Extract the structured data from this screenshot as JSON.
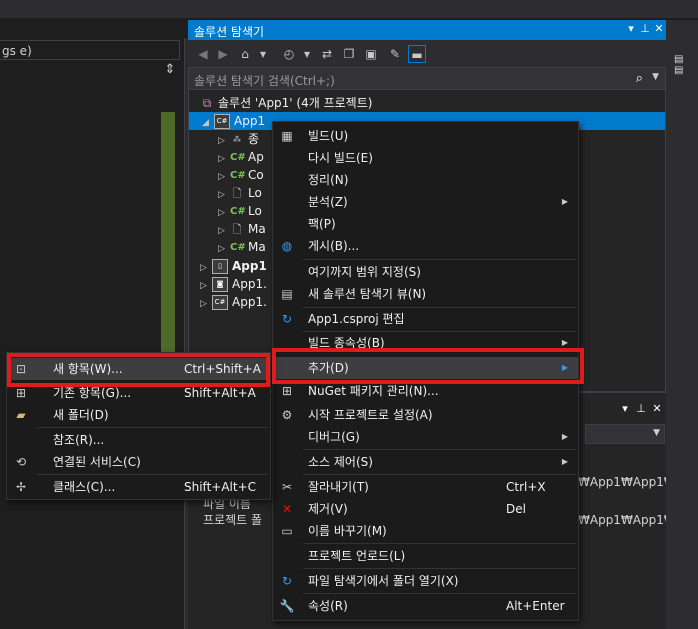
{
  "left_panel": {
    "combo_text": "gs e)"
  },
  "solution_explorer": {
    "title": "솔루션 탐색기",
    "search_placeholder": "솔루션 탐색기 검색(Ctrl+;)",
    "tree": [
      {
        "label": "솔루션 'App1' (4개 프로젝트)",
        "type": "solution"
      },
      {
        "label": "App1",
        "type": "project-selected"
      },
      {
        "label": "종",
        "type": "refs"
      },
      {
        "label": "Ap",
        "type": "cs"
      },
      {
        "label": "Co",
        "type": "cs"
      },
      {
        "label": "Lo",
        "type": "xaml"
      },
      {
        "label": "Lo",
        "type": "cs"
      },
      {
        "label": "Ma",
        "type": "xaml"
      },
      {
        "label": "Ma",
        "type": "cs"
      },
      {
        "label": "App1",
        "type": "project-bold"
      },
      {
        "label": "App1.",
        "type": "project"
      },
      {
        "label": "App1.",
        "type": "project"
      }
    ]
  },
  "lower_panel": {
    "paths": [
      "₩App1₩App1₩A",
      "₩App1₩App1₩"
    ],
    "rows": [
      "파일 이름",
      "프로젝트 폴"
    ]
  },
  "context_menu": {
    "items": [
      {
        "label": "빌드(U)",
        "icon": "build-icon"
      },
      {
        "label": "다시 빌드(E)"
      },
      {
        "label": "정리(N)"
      },
      {
        "label": "분석(Z)",
        "submenu": true
      },
      {
        "label": "팩(P)"
      },
      {
        "label": "게시(B)...",
        "icon": "globe-icon"
      },
      {
        "label": "여기까지 범위 지정(S)"
      },
      {
        "label": "새 솔루션 탐색기 뷰(N)",
        "icon": "new-view-icon"
      },
      {
        "label": "App1.csproj 편집",
        "icon": "refresh-icon"
      },
      {
        "label": "빌드 종속성(B)",
        "submenu": true
      },
      {
        "label": "추가(D)",
        "submenu": true,
        "highlighted": true
      },
      {
        "label": "NuGet 패키지 관리(N)...",
        "icon": "nuget-icon"
      },
      {
        "label": "시작 프로젝트로 설정(A)",
        "icon": "gear-icon"
      },
      {
        "label": "디버그(G)",
        "submenu": true
      },
      {
        "label": "소스 제어(S)",
        "submenu": true
      },
      {
        "label": "잘라내기(T)",
        "shortcut": "Ctrl+X",
        "icon": "scissors-icon"
      },
      {
        "label": "제거(V)",
        "shortcut": "Del",
        "icon": "remove-icon"
      },
      {
        "label": "이름 바꾸기(M)",
        "icon": "rename-icon"
      },
      {
        "label": "프로젝트 언로드(L)"
      },
      {
        "label": "파일 탐색기에서 폴더 열기(X)",
        "icon": "refresh-icon"
      },
      {
        "label": "속성(R)",
        "shortcut": "Alt+Enter",
        "icon": "wrench-icon"
      }
    ]
  },
  "add_submenu": {
    "items": [
      {
        "label": "새 항목(W)...",
        "shortcut": "Ctrl+Shift+A",
        "icon": "new-item-icon",
        "highlighted": true
      },
      {
        "label": "기존 항목(G)...",
        "shortcut": "Shift+Alt+A",
        "icon": "existing-item-icon"
      },
      {
        "label": "새 폴더(D)",
        "icon": "new-folder-icon"
      },
      {
        "label": "참조(R)..."
      },
      {
        "label": "연결된 서비스(C)",
        "icon": "connected-service-icon"
      },
      {
        "label": "클래스(C)...",
        "shortcut": "Shift+Alt+C",
        "icon": "class-icon"
      }
    ]
  },
  "colors": {
    "accent": "#007acc",
    "highlight": "#e01b1b",
    "menu_bg": "#1b1b1c"
  }
}
